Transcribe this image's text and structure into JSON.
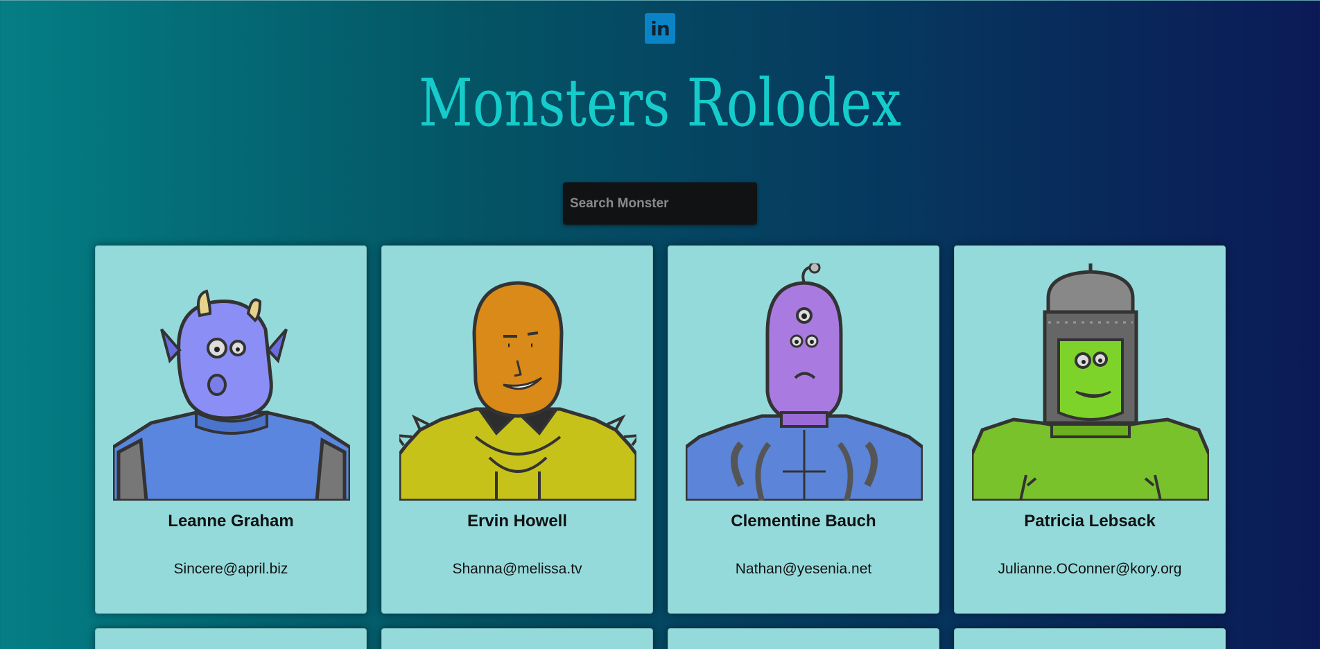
{
  "app": {
    "title": "Monsters Rolodex",
    "linkedin_label": "in"
  },
  "search": {
    "placeholder": "Search Monster",
    "value": ""
  },
  "colors": {
    "title": "#16cccb",
    "card_background": "#95dadb",
    "linkedin": "#0a84c7"
  },
  "monsters": [
    {
      "name": "Leanne Graham",
      "email": "Sincere@april.biz",
      "icon": "blue-horned-monster-icon"
    },
    {
      "name": "Ervin Howell",
      "email": "Shanna@melissa.tv",
      "icon": "orange-spiky-monster-icon"
    },
    {
      "name": "Clementine Bauch",
      "email": "Nathan@yesenia.net",
      "icon": "purple-three-eyed-monster-icon"
    },
    {
      "name": "Patricia Lebsack",
      "email": "Julianne.OConner@kory.org",
      "icon": "green-robot-monster-icon"
    }
  ]
}
